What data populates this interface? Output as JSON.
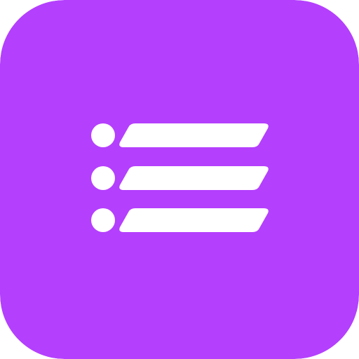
{
  "app_icon": {
    "icon": "list-bullets-icon",
    "background_color": "#b43ffd",
    "glyph_color": "#ffffff",
    "rows": [
      {
        "bullet": "bullet-dot",
        "bar": "list-bar"
      },
      {
        "bullet": "bullet-dot",
        "bar": "list-bar"
      },
      {
        "bullet": "bullet-dot",
        "bar": "list-bar"
      }
    ]
  }
}
